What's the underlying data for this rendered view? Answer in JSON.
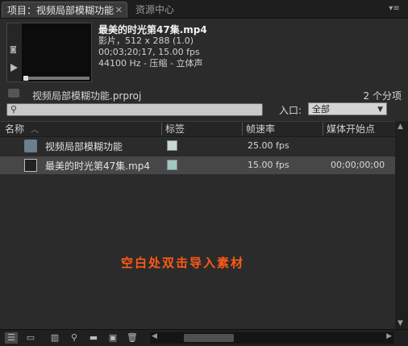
{
  "tabs": [
    {
      "label": "项目：视频局部模糊功能"
    },
    {
      "label": "资源中心"
    }
  ],
  "clip_info": {
    "name": "最美的时光第47集.mp4",
    "type": "影片，512 x 288 (1.0)",
    "duration": "00;03;20;17, 15.00 fps",
    "audio": "44100 Hz - 压缩 - 立体声"
  },
  "project": {
    "file_name": "视频局部模糊功能.prproj",
    "item_count": "2 个分项"
  },
  "search": {
    "placeholder": ""
  },
  "entry": {
    "label": "入口:",
    "selected": "全部"
  },
  "columns": [
    "名称",
    "标签",
    "帧速率",
    "媒体开始点"
  ],
  "rows": [
    {
      "name": "视频局部模糊功能",
      "label_color": "#c8d8d8",
      "fps": "25.00 fps",
      "start": ""
    },
    {
      "name": "最美的时光第47集.mp4",
      "label_color": "#a0c8c0",
      "fps": "15.00 fps",
      "start": "00;00;00;00"
    }
  ],
  "hint": "空白处双击导入素材",
  "icons": {
    "close": "close-icon",
    "panel_menu": "panel-menu-icon",
    "search": "search-icon",
    "sort": "sort-ascending-icon"
  },
  "colors": {
    "hint": "#ff5a14",
    "background": "#2b2b2b",
    "selected_row": "#474747"
  }
}
